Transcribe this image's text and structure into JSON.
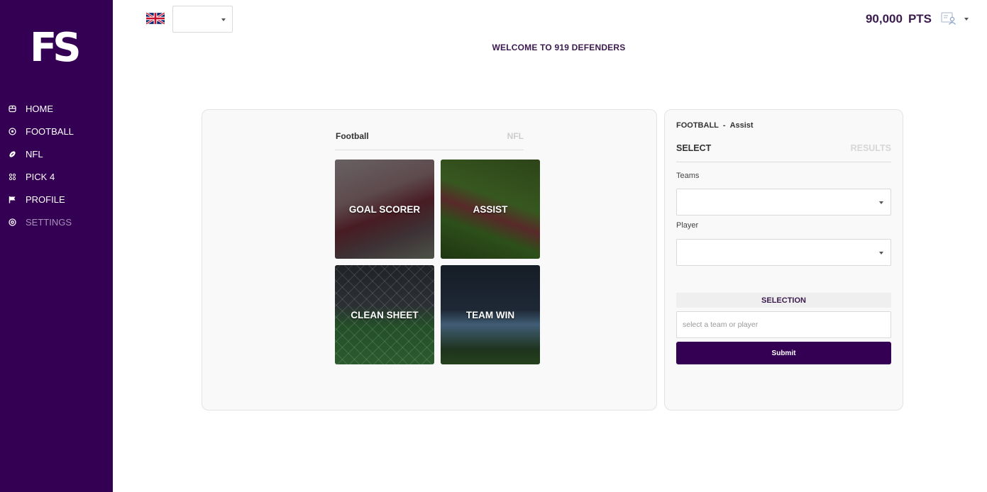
{
  "app": {
    "logo_text": "FS",
    "welcome": "WELCOME TO 919 DEFENDERS"
  },
  "header": {
    "points_value": "90,000",
    "points_unit": "PTS",
    "language_flag": "uk-flag-icon",
    "language_select_value": ""
  },
  "sidebar": {
    "items": [
      {
        "label": "HOME",
        "icon": "home-icon"
      },
      {
        "label": "FOOTBALL",
        "icon": "football-icon"
      },
      {
        "label": "NFL",
        "icon": "nfl-ball-icon"
      },
      {
        "label": "PICK 4",
        "icon": "pick4-icon"
      },
      {
        "label": "PROFILE",
        "icon": "flag-icon"
      },
      {
        "label": "SETTINGS",
        "icon": "settings-icon"
      }
    ]
  },
  "main": {
    "tabs": [
      {
        "label": "Football",
        "active": true
      },
      {
        "label": "NFL",
        "active": false
      }
    ],
    "cards": [
      {
        "label": "GOAL SCORER"
      },
      {
        "label": "ASSIST"
      },
      {
        "label": "CLEAN SHEET"
      },
      {
        "label": "TEAM WIN"
      }
    ]
  },
  "side": {
    "breadcrumb_main": "FOOTBALL",
    "breadcrumb_sep": "-",
    "breadcrumb_sub": "Assist",
    "tabs": [
      {
        "label": "SELECT",
        "active": true
      },
      {
        "label": "RESULTS",
        "active": false
      }
    ],
    "teams_label": "Teams",
    "teams_value": "",
    "player_label": "Player",
    "player_value": "",
    "selection_header": "SELECTION",
    "selection_placeholder": "select a team or player",
    "submit_label": "Submit"
  },
  "colors": {
    "brand": "#340053",
    "heading_text": "#3b1a4e",
    "muted_tab": "#cccccc"
  }
}
